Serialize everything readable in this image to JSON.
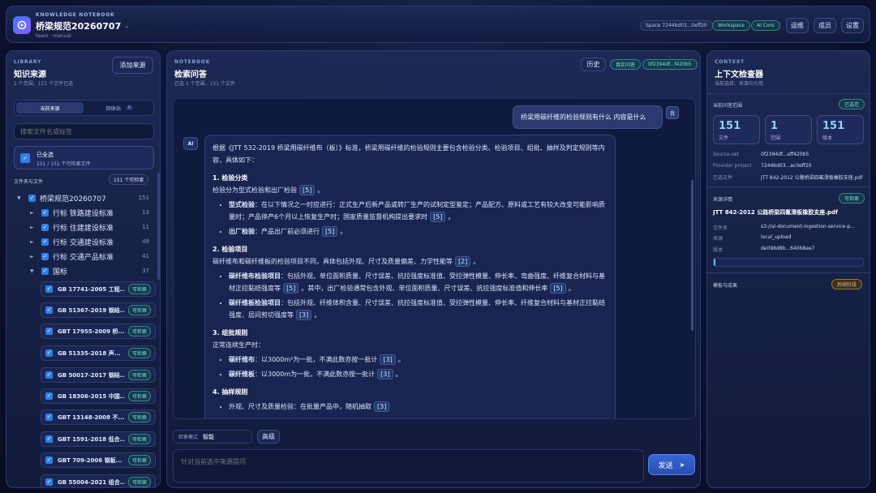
{
  "header": {
    "eyebrow": "KNOWLEDGE NOTEBOOK",
    "title": "桥梁规范20260707",
    "subtitle": "team · manual",
    "space_pill": "Space 7244bd03...0eff20",
    "workspace_pill": "Workspace",
    "aicore_pill": "AI Core",
    "buttons": [
      "运维",
      "成员",
      "设置"
    ]
  },
  "library": {
    "eyebrow": "LIBRARY",
    "title": "知识来源",
    "subtitle": "1 个范围，151 个文件已选",
    "add_button": "添加来源",
    "tabs": {
      "current": "当前来源",
      "recycle": "回收站",
      "recycle_count": "0"
    },
    "search_placeholder": "搜索文件名或标签",
    "select_all": {
      "title": "已全选",
      "detail": "151 / 151 个可检索文件"
    },
    "section_label": "文件夹与文件",
    "section_badge": "151 个可检索",
    "tree": [
      {
        "label": "桥梁规范20260707",
        "count": "151",
        "arrow": "▼"
      },
      {
        "label": "行标 铁路建设标准",
        "count": "13",
        "arrow": "►"
      },
      {
        "label": "行标 住建建设标准",
        "count": "11",
        "arrow": "►"
      },
      {
        "label": "行标 交通建设标准",
        "count": "49",
        "arrow": "►"
      },
      {
        "label": "行标 交通产品标准",
        "count": "41",
        "arrow": "►"
      },
      {
        "label": "国标",
        "count": "37",
        "arrow": "▼"
      }
    ],
    "files": [
      {
        "title": "GB 17741-2005 工程...",
        "tag": "可检索"
      },
      {
        "title": "GB 51367-2019 钢结...",
        "tag": "可检索"
      },
      {
        "title": "GBT 17955-2009 桥...",
        "tag": "可检索"
      },
      {
        "title": "GB 51335-2018 声...",
        "tag": "可检索"
      },
      {
        "title": "GB 50017-2017 钢结...",
        "tag": "可检索"
      },
      {
        "title": "GB 18306-2015 中国...",
        "tag": "可检索"
      },
      {
        "title": "GBT 13148-2008 不...",
        "tag": "可检索"
      },
      {
        "title": "GBT 1591-2018 低合...",
        "tag": "可检索"
      },
      {
        "title": "GBT 709-2006 钢板...",
        "tag": "可检索"
      },
      {
        "title": "GB 55004-2021 组合...",
        "tag": "可检索"
      }
    ]
  },
  "notebook": {
    "eyebrow": "NOTEBOOK",
    "title": "检索问答",
    "subtitle": "已选 1 个范围，151 个文件",
    "history_button": "历史",
    "real_pill": "真实问答",
    "id_pill": "0f2394df...f420b5",
    "user_avatar": "我",
    "ai_avatar": "AI",
    "question": "桥梁用碳纤维的检验规则有什么 内容是什么",
    "answer": {
      "intro": "根据《JTT 532-2019 桥梁用碳纤维布（板）》标准，桥梁用碳纤维的检验规则主要包含检验分类、检验项目、组批、抽样及判定规则等内容，具体如下：",
      "s1_title": "1. 检验分类",
      "s1_line": "检验分为型式检验和出厂检验",
      "s1_line_ref": "[5]",
      "s1_b1_label": "型式检验",
      "s1_b1_text": "：在以下情况之一时应进行：正式生产后新产品或转厂生产的试制定型鉴定；产品配方、原料或工艺有较大改变可能影响质量时；产品停产6个月以上恢复生产时；国家质量监督机构提出要求时",
      "s1_b1_ref": "[5]",
      "s1_b2_label": "出厂检验",
      "s1_b2_text": "：产品出厂前必须进行",
      "s1_b2_ref": "[5]",
      "s2_title": "2. 检验项目",
      "s2_line": "碳纤维布和碳纤维板的检验项目不同，具体包括外观、尺寸及质量偏差、力学性能等",
      "s2_line_ref": "[2]",
      "s2_b1_label": "碳纤维布检验项目",
      "s2_b1_text": "：包括外观、单位面积质量、尺寸误差、抗拉强度标准值、受拉弹性模量、伸长率、弯曲强度、纤维复合材料与基材正拉黏结强度等",
      "s2_b1_ref": "[5]",
      "s2_b1_text2": "。其中，出厂检验通常包含外观、单位面积质量、尺寸误差、抗拉强度标准值和伸长率",
      "s2_b1_ref2": "[5]",
      "s2_b2_label": "碳纤维板检验项目",
      "s2_b2_text": "：包括外观、纤维体积含量、尺寸误差、抗拉强度标准值、受拉弹性模量、伸长率、纤维复合材料与基材正拉黏结强度、层间剪切强度等",
      "s2_b2_ref": "[3]",
      "s3_title": "3. 组批规则",
      "s3_line": "正常连续生产时：",
      "s3_b1_label": "碳纤维布",
      "s3_b1_text": "：以3000m²为一批，不满此数亦按一批计",
      "s3_b1_ref": "[3]",
      "s3_b2_label": "碳纤维板",
      "s3_b2_text": "：以3000m为一批，不满此数亦按一批计",
      "s3_b2_ref": "[3]",
      "s4_title": "4. 抽样规则",
      "s4_b1_text": "外观、尺寸及质量检验：在批量产品中，随机抽取",
      "s4_b1_ref": "[3]"
    },
    "search_mode_label": "检索模式",
    "search_mode_value": "智能",
    "advanced_button": "高级",
    "input_placeholder": "针对当前选中来源提问",
    "send_button": "发送",
    "send_icon": "➤"
  },
  "context": {
    "eyebrow": "CONTEXT",
    "title": "上下文检查器",
    "subtitle": "当前选择、来源与引用",
    "scope_label": "当前问答范围",
    "scope_badge": "已选范",
    "stats": [
      {
        "num": "151",
        "label": "文件"
      },
      {
        "num": "1",
        "label": "范围"
      },
      {
        "num": "151",
        "label": "版本"
      }
    ],
    "kv1": [
      {
        "k": "Source-set",
        "v": "0f2394df...aff420b5"
      },
      {
        "k": "Provider project",
        "v": "7244bd03...ac0eff20"
      },
      {
        "k": "已选文件",
        "v": "JTT 842-2012 公路桥梁四氟滑板橡胶支座.pdf"
      }
    ],
    "detail_label": "来源详情",
    "detail_badge": "可检索",
    "detail_title": "JTT 842-2012 公路桥梁四氟滑板橡胶支座.pdf",
    "kv2": [
      {
        "k": "文件名",
        "v": "s3://ai-document-ingestion-service-p..."
      },
      {
        "k": "来源",
        "v": "local_upload"
      },
      {
        "k": "版本",
        "v": "de098d8b...64068ee7"
      }
    ],
    "progress": 0.01,
    "template_label": "模板与成果",
    "template_badge": "后续阶段"
  },
  "colors": {
    "accent": "#2f7fe8",
    "teal": "#2d8c86",
    "amber": "#a7791e",
    "background": "#0b1230"
  }
}
